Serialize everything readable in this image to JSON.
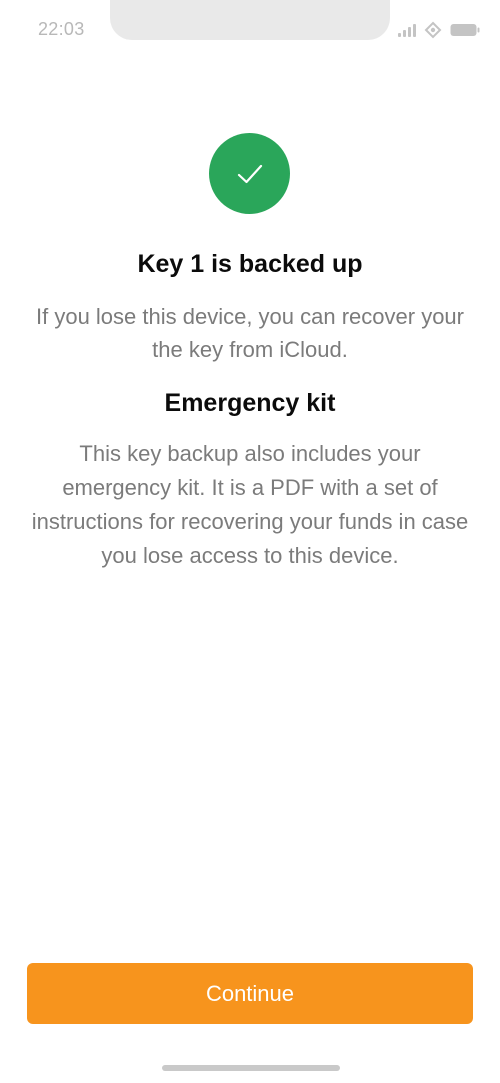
{
  "status_bar": {
    "time": "22:03",
    "icons": [
      "signal-icon",
      "connect-icon",
      "battery-icon"
    ]
  },
  "confirmation": {
    "icon": "checkmark-icon",
    "icon_bg_color": "#2aa65a",
    "title": "Key 1 is backed up",
    "subtitle": "If you lose this device, you can recover your the key from iCloud."
  },
  "emergency_kit": {
    "title": "Emergency kit",
    "body": "This key backup also includes your emergency kit. It is a PDF with a set of instructions for recovering your funds in case you lose access to this device."
  },
  "actions": {
    "continue_label": "Continue",
    "button_color": "#f7941d"
  }
}
